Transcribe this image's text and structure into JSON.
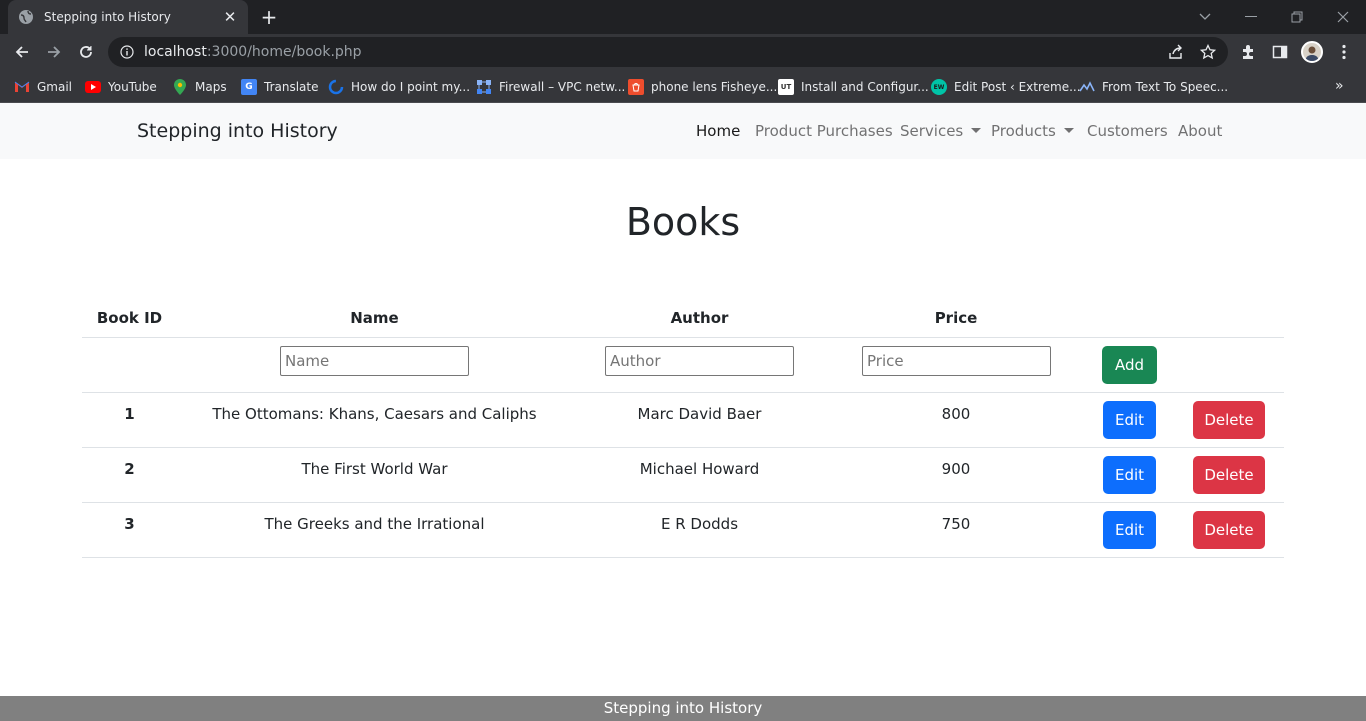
{
  "browser": {
    "tab_title": "Stepping into History",
    "url_host": "localhost",
    "url_path": ":3000/home/book.php",
    "bookmarks": [
      {
        "label": "Gmail",
        "icon": "gmail-icon",
        "color": "#ea4335"
      },
      {
        "label": "YouTube",
        "icon": "youtube-icon",
        "color": "#ff0000"
      },
      {
        "label": "Maps",
        "icon": "maps-icon",
        "color": "#34a853"
      },
      {
        "label": "Translate",
        "icon": "translate-icon",
        "color": "#4285f4"
      },
      {
        "label": "How do I point my...",
        "icon": "link-icon",
        "color": "#1a73e8"
      },
      {
        "label": "Firewall – VPC netw...",
        "icon": "network-icon",
        "color": "#4285f4"
      },
      {
        "label": "phone lens Fisheye...",
        "icon": "shop-icon",
        "color": "#ee4d2d"
      },
      {
        "label": "Install and Configur...",
        "icon": "ut-icon",
        "color": "#ffffff"
      },
      {
        "label": "Edit Post ‹ Extreme...",
        "icon": "ew-icon",
        "color": "#00c4a7"
      },
      {
        "label": "From Text To Speec...",
        "icon": "speech-icon",
        "color": "#8ab4f8"
      }
    ]
  },
  "navbar": {
    "brand": "Stepping into History",
    "links": [
      {
        "label": "Home",
        "active": true
      },
      {
        "label": "Product Purchases"
      },
      {
        "label": "Services",
        "dropdown": true
      },
      {
        "label": "Products",
        "dropdown": true
      },
      {
        "label": "Customers"
      },
      {
        "label": "About"
      }
    ]
  },
  "page": {
    "title": "Books"
  },
  "table": {
    "headers": [
      "Book ID",
      "Name",
      "Author",
      "Price"
    ],
    "form": {
      "name_placeholder": "Name",
      "author_placeholder": "Author",
      "price_placeholder": "Price",
      "add_label": "Add"
    },
    "rows": [
      {
        "id": "1",
        "name": "The Ottomans: Khans, Caesars and Caliphs",
        "author": "Marc David Baer",
        "price": "800"
      },
      {
        "id": "2",
        "name": "The First World War",
        "author": "Michael Howard",
        "price": "900"
      },
      {
        "id": "3",
        "name": "The Greeks and the Irrational",
        "author": "E R Dodds",
        "price": "750"
      }
    ],
    "edit_label": "Edit",
    "delete_label": "Delete"
  },
  "footer": {
    "text": "Stepping into History"
  },
  "colors": {
    "add": "#198754",
    "edit": "#0d6efd",
    "delete": "#dc3545"
  }
}
